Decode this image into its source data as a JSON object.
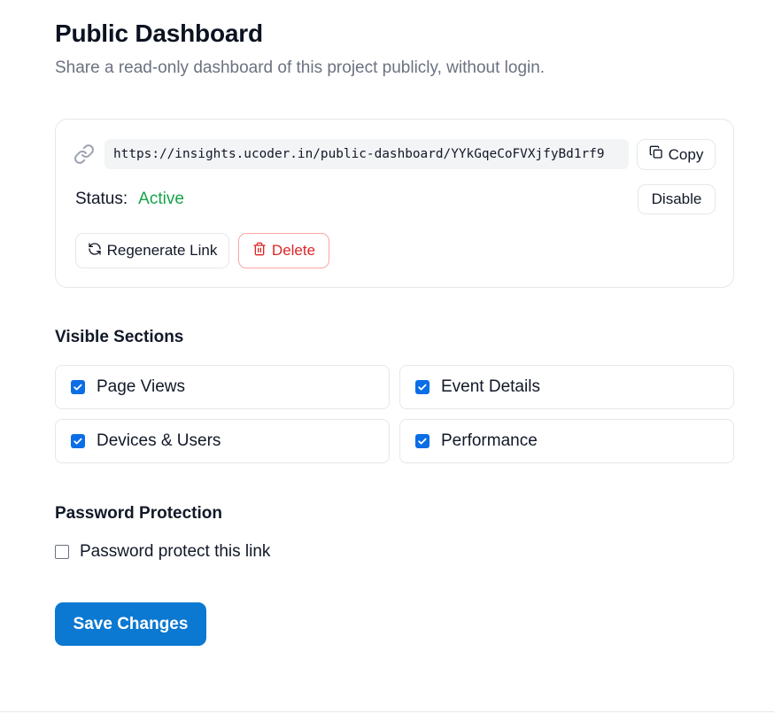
{
  "header": {
    "title": "Public Dashboard",
    "subtitle": "Share a read-only dashboard of this project publicly, without login."
  },
  "link_card": {
    "url": "https://insights.ucoder.in/public-dashboard/YYkGqeCoFVXjfyBd1rf9",
    "copy_label": "Copy",
    "status_label": "Status:",
    "status_value": "Active",
    "disable_label": "Disable",
    "regenerate_label": "Regenerate Link",
    "delete_label": "Delete"
  },
  "visible_sections": {
    "title": "Visible Sections",
    "options": [
      {
        "label": "Page Views",
        "checked": true
      },
      {
        "label": "Event Details",
        "checked": true
      },
      {
        "label": "Devices & Users",
        "checked": true
      },
      {
        "label": "Performance",
        "checked": true
      }
    ]
  },
  "password_protection": {
    "title": "Password Protection",
    "option_label": "Password protect this link",
    "checked": false
  },
  "save_label": "Save Changes",
  "colors": {
    "primary": "#0b78d1",
    "checkbox": "#0b6ee6",
    "active_status": "#16a34a",
    "danger": "#dc2626",
    "border": "#e5e7eb"
  },
  "icons": {
    "link": "link-icon",
    "copy": "copy-icon",
    "regenerate": "refresh-icon",
    "delete": "trash-icon",
    "check": "checkmark-icon"
  }
}
